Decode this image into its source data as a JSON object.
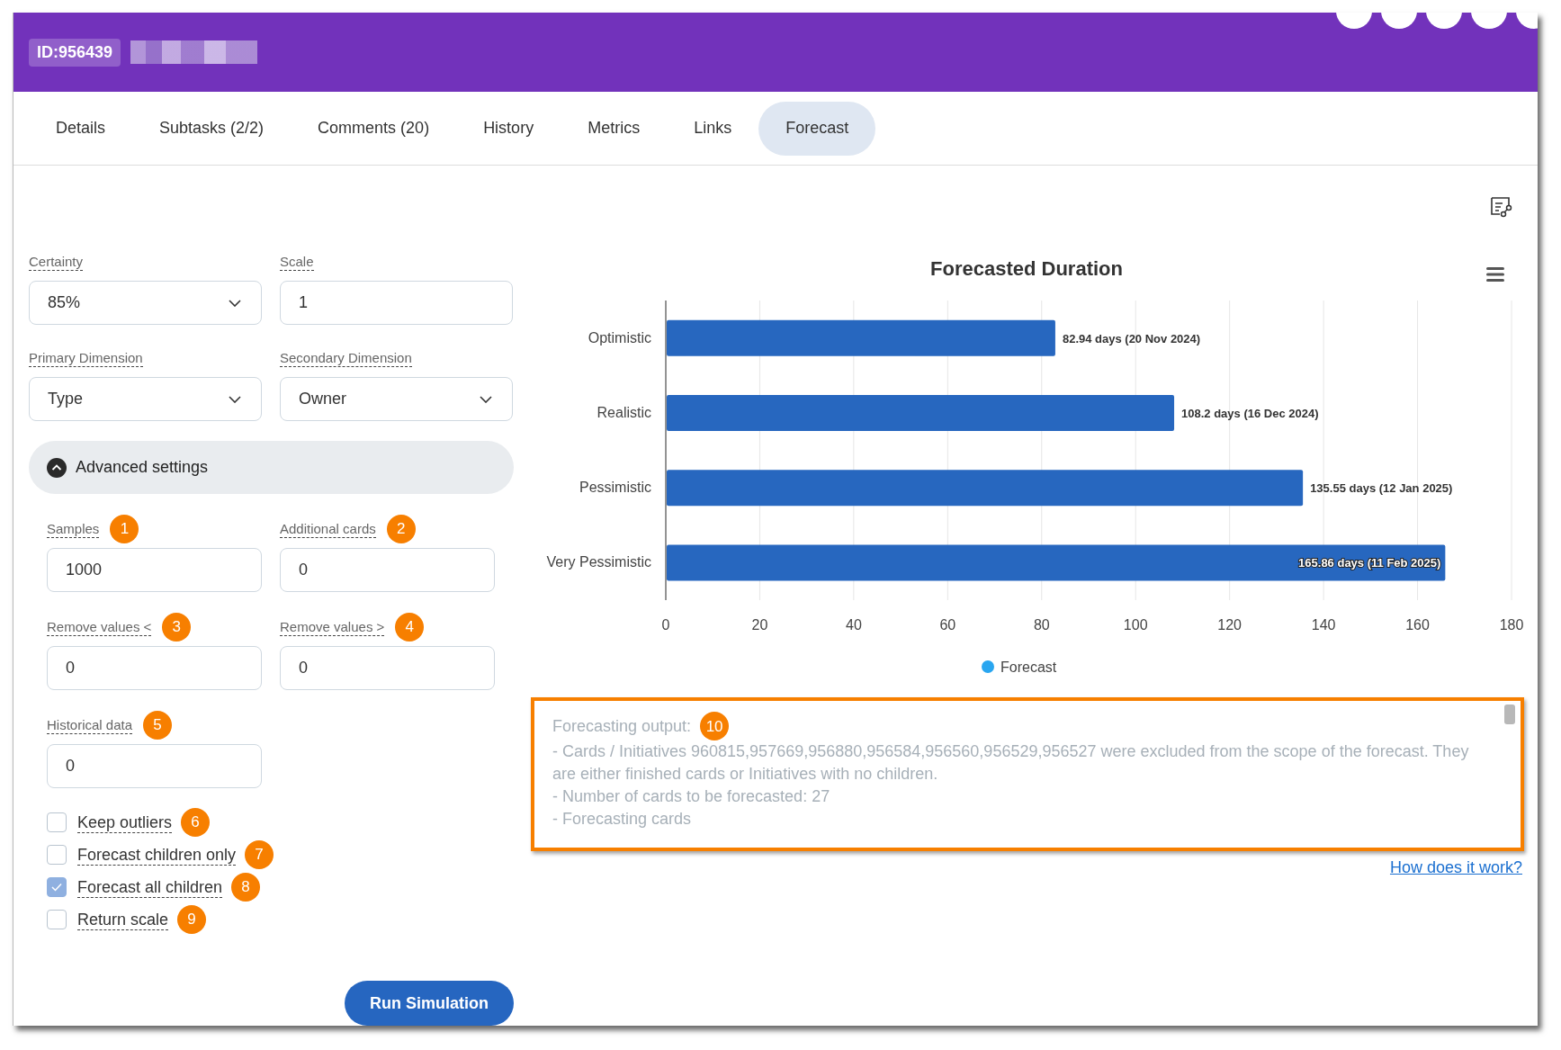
{
  "header": {
    "id_label": "ID:956439"
  },
  "tabs": [
    {
      "label": "Details",
      "selected": false
    },
    {
      "label": "Subtasks (2/2)",
      "selected": false
    },
    {
      "label": "Comments (20)",
      "selected": false
    },
    {
      "label": "History",
      "selected": false
    },
    {
      "label": "Metrics",
      "selected": false
    },
    {
      "label": "Links",
      "selected": false
    },
    {
      "label": "Forecast",
      "selected": true
    }
  ],
  "form": {
    "fields": [
      {
        "label": "Certainty",
        "value": "85%",
        "kind": "select"
      },
      {
        "label": "Scale",
        "value": "1",
        "kind": "input"
      },
      {
        "label": "Primary Dimension",
        "value": "Type",
        "kind": "select"
      },
      {
        "label": "Secondary Dimension",
        "value": "Owner",
        "kind": "select"
      }
    ],
    "advanced_settings": {
      "label": "Advanced settings",
      "expanded": true
    },
    "advanced_fields": [
      {
        "label": "Samples",
        "value": "1000",
        "badge": "1"
      },
      {
        "label": "Additional cards",
        "value": "0",
        "badge": "2"
      },
      {
        "label": "Remove values <",
        "value": "0",
        "badge": "3"
      },
      {
        "label": "Remove values >",
        "value": "0",
        "badge": "4"
      },
      {
        "label": "Historical data",
        "value": "0",
        "badge": "5"
      }
    ],
    "options": [
      {
        "label": "Keep outliers",
        "checked": false,
        "badge": "6"
      },
      {
        "label": "Forecast children only",
        "checked": false,
        "badge": "7"
      },
      {
        "label": "Forecast all children",
        "checked": true,
        "badge": "8"
      },
      {
        "label": "Return scale",
        "checked": false,
        "badge": "9"
      }
    ],
    "run_button": "Run Simulation"
  },
  "chart": {
    "chart_data": {
      "type": "bar",
      "orientation": "horizontal",
      "title": "Forecasted Duration",
      "categories": [
        "Optimistic",
        "Realistic",
        "Pessimistic",
        "Very Pessimistic"
      ],
      "series": [
        {
          "name": "Forecast",
          "color": "#2767bf",
          "values": [
            82.9,
            108.2,
            135.6,
            165.9
          ]
        }
      ],
      "grid": true,
      "xlim": [
        0,
        180
      ],
      "xticks": [
        0,
        20,
        40,
        60,
        80,
        100,
        120,
        140,
        160,
        180
      ],
      "value_labels": [
        "82.94 days (20 Nov 2024)",
        "108.2 days (16 Dec 2024)",
        "135.55 days (12 Jan 2025)",
        "165.86 days (11 Feb 2025)"
      ]
    }
  },
  "output": {
    "badge": "10",
    "lines": [
      "Forecasting output:",
      "- Cards / Initiatives 960815,957669,956880,956584,956560,956529,956527 were excluded from the scope of the forecast. They are either finished cards or Initiatives with no children.",
      "- Number of cards to be forecasted: 27",
      "- Forecasting cards"
    ]
  },
  "help_link": "How does it work?"
}
